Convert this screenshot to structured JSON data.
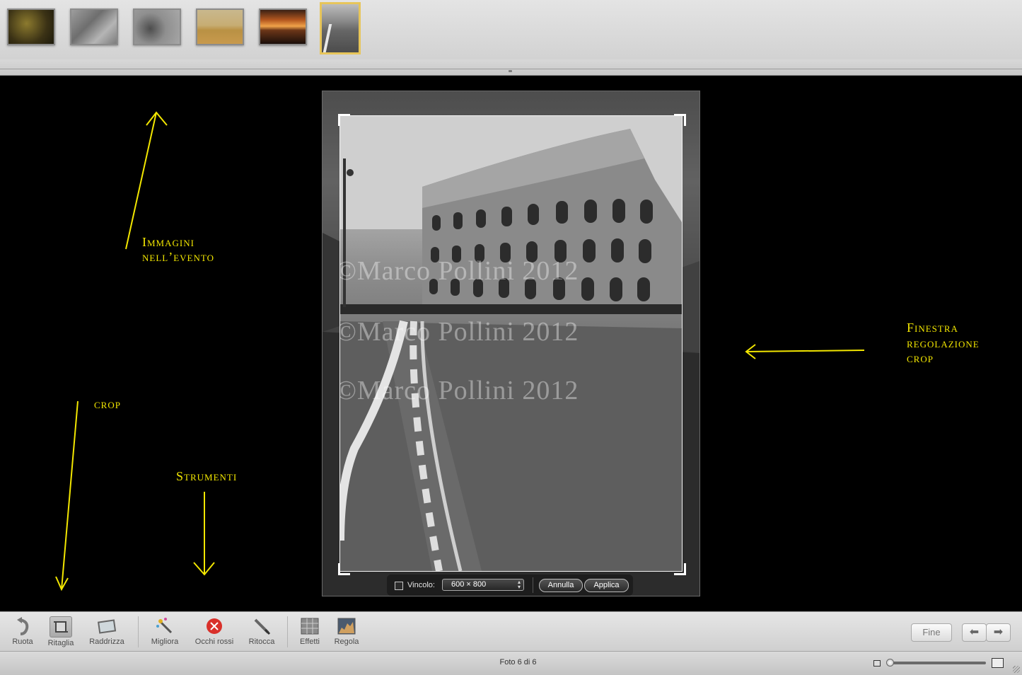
{
  "filmstrip": {
    "thumbnails": [
      {
        "name": "thumb-1",
        "selected": false
      },
      {
        "name": "thumb-2",
        "selected": false
      },
      {
        "name": "thumb-3",
        "selected": false
      },
      {
        "name": "thumb-4",
        "selected": false
      },
      {
        "name": "thumb-5",
        "selected": false
      },
      {
        "name": "thumb-6",
        "selected": true
      }
    ]
  },
  "photo": {
    "watermark_1": "©Marco Pollini 2012",
    "watermark_2": "©Marco Pollini 2012",
    "watermark_3": "©Marco Pollini 2012"
  },
  "crop_hud": {
    "constraint_label": "Vincolo:",
    "constraint_checked": false,
    "constraint_value": "600 × 800",
    "cancel_label": "Annulla",
    "apply_label": "Applica"
  },
  "annotations": {
    "events_line1": "Immagini",
    "events_line2": "nell’evento",
    "crop_window_line1": "Finestra",
    "crop_window_line2": "regolazione",
    "crop_window_line3": "crop",
    "crop": "crop",
    "tools": "Strumenti",
    "color": "#f2e600"
  },
  "toolbar": {
    "rotate": "Ruota",
    "crop": "Ritaglia",
    "straighten": "Raddrizza",
    "enhance": "Migliora",
    "red_eye": "Occhi rossi",
    "retouch": "Ritocca",
    "effects": "Effetti",
    "adjust": "Regola",
    "done": "Fine"
  },
  "status": {
    "photo_counter": "Foto 6 di 6"
  },
  "colors": {
    "selection": "#e7c55a",
    "red_eye_icon": "#d9302a"
  }
}
